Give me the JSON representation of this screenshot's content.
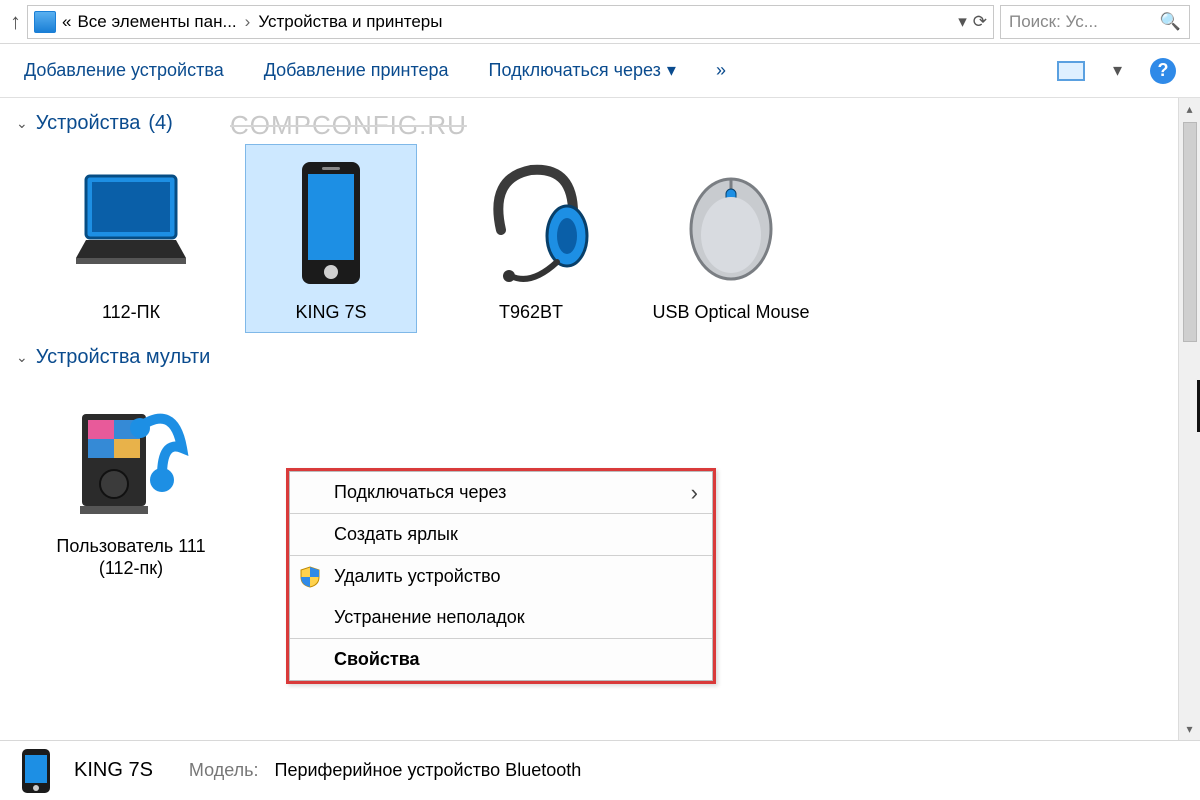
{
  "breadcrumb": {
    "prefix_glyph": "«",
    "part1": "Все элементы пан...",
    "arrow": "›",
    "part2": "Устройства и принтеры"
  },
  "search": {
    "placeholder": "Поиск: Ус..."
  },
  "toolbar": {
    "add_device": "Добавление устройства",
    "add_printer": "Добавление принтера",
    "connect_via": "Подключаться через",
    "overflow": "»"
  },
  "groups": {
    "devices": {
      "label": "Устройства",
      "count": 4
    },
    "multimedia": {
      "label": "Устройства мульти"
    }
  },
  "watermark": "COMPCONFIG.RU",
  "devices": [
    {
      "label": "112-ПК"
    },
    {
      "label": "KING 7S"
    },
    {
      "label": "T962BT"
    },
    {
      "label": "USB Optical Mouse"
    }
  ],
  "multimedia_devices": [
    {
      "label": "Пользователь 111 (112-пк)"
    }
  ],
  "context_menu": {
    "connect_via": "Подключаться через",
    "create_shortcut": "Создать ярлык",
    "remove_device": "Удалить устройство",
    "troubleshoot": "Устранение неполадок",
    "properties": "Свойства"
  },
  "details": {
    "selected_name": "KING 7S",
    "model_label": "Модель:",
    "model_value": "Периферийное устройство Bluetooth"
  }
}
